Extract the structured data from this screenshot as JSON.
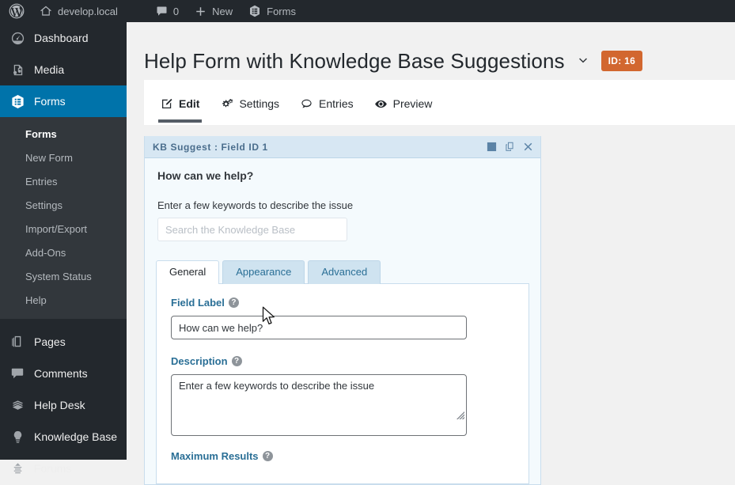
{
  "adminbar": {
    "logo_icon": "wordpress-logo-icon",
    "site_icon": "home-icon",
    "site_name": "develop.local",
    "comments_icon": "comment-bubble-icon",
    "comments_count": "0",
    "new_icon": "plus-icon",
    "new_label": "New",
    "forms_icon": "forms-icon",
    "forms_label": "Forms"
  },
  "sidebar": {
    "top_items": [
      {
        "label": "Dashboard",
        "icon": "dashboard-icon"
      },
      {
        "label": "Media",
        "icon": "media-icon"
      },
      {
        "label": "Forms",
        "icon": "forms-icon",
        "current": true
      }
    ],
    "submenu": [
      {
        "label": "Forms",
        "current": true
      },
      {
        "label": "New Form"
      },
      {
        "label": "Entries"
      },
      {
        "label": "Settings"
      },
      {
        "label": "Import/Export"
      },
      {
        "label": "Add-Ons"
      },
      {
        "label": "System Status"
      },
      {
        "label": "Help"
      }
    ],
    "bottom_items": [
      {
        "label": "Pages",
        "icon": "pages-icon"
      },
      {
        "label": "Comments",
        "icon": "comment-bubble-icon"
      },
      {
        "label": "Help Desk",
        "icon": "help-desk-icon"
      },
      {
        "label": "Knowledge Base",
        "icon": "lightbulb-icon"
      },
      {
        "label": "Forums",
        "icon": "forums-icon"
      }
    ]
  },
  "header": {
    "title": "Help Form with Knowledge Base Suggestions",
    "chevron_icon": "chevron-down-icon",
    "id_badge": "ID: 16"
  },
  "tabs": [
    {
      "label": "Edit",
      "icon": "edit-pencil-icon",
      "active": true
    },
    {
      "label": "Settings",
      "icon": "gears-icon",
      "active": false
    },
    {
      "label": "Entries",
      "icon": "comment-bubble-icon",
      "active": false
    },
    {
      "label": "Preview",
      "icon": "eye-icon",
      "active": false
    }
  ],
  "field": {
    "head_title": "KB Suggest : Field ID 1",
    "head_icons": [
      {
        "name": "collapse-icon"
      },
      {
        "name": "duplicate-icon"
      },
      {
        "name": "delete-icon"
      }
    ],
    "preview": {
      "label": "How can we help?",
      "description": "Enter a few keywords to describe the issue",
      "search_placeholder": "Search the Knowledge Base"
    },
    "settings_tabs": [
      {
        "label": "General",
        "active": true
      },
      {
        "label": "Appearance",
        "active": false
      },
      {
        "label": "Advanced",
        "active": false
      }
    ],
    "settings": {
      "field_label_title": "Field Label",
      "field_label_value": "How can we help?",
      "description_title": "Description",
      "description_value": "Enter a few keywords to describe the issue",
      "maximum_results_title": "Maximum Results",
      "help_glyph": "?"
    }
  },
  "colors": {
    "admin_dark": "#23282d",
    "submenu_dark": "#32373c",
    "accent_blue": "#0073aa",
    "badge_orange": "#d2672f",
    "panel_blue": "#f4fafd",
    "panel_head_blue": "#d7e7f3",
    "label_blue": "#2a6f96",
    "page_bg": "#f1f1f1"
  }
}
